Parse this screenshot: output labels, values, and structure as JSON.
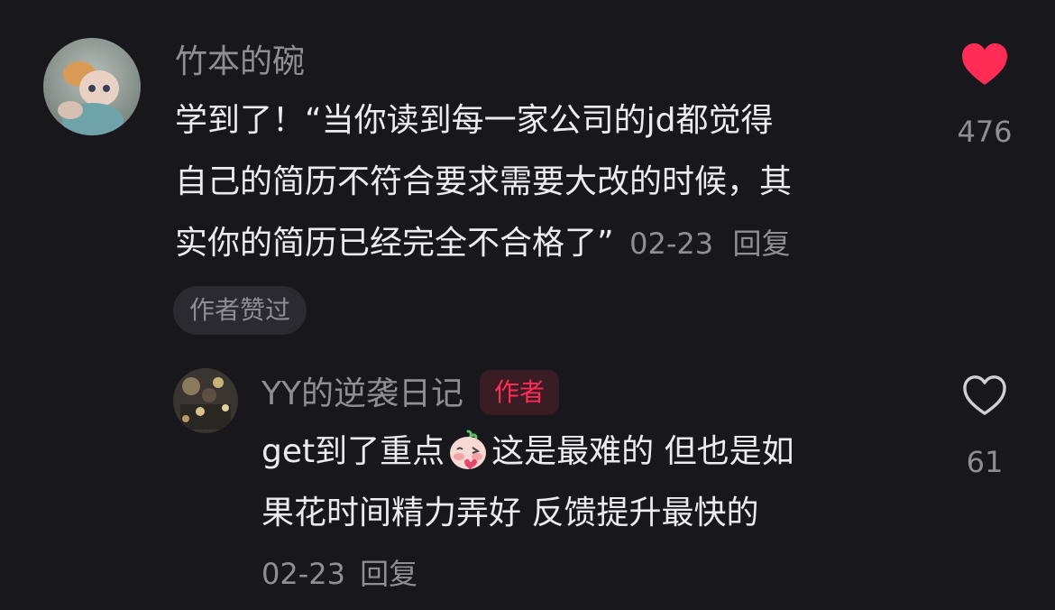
{
  "colors": {
    "background": "#18181c",
    "text_primary": "#ececf0",
    "text_secondary": "#8e8e95",
    "like_red": "#ff2c55",
    "badge_bg": "#2a2a30"
  },
  "comment": {
    "username": "竹本的碗",
    "text_lines": [
      "学到了！“当你读到每一家公司的jd都觉得",
      "自己的简历不符合要求需要大改的时候，其",
      "实你的简历已经完全不合格了”"
    ],
    "date": "02-23",
    "reply_label": "回复",
    "like_count": "476",
    "liked": true,
    "like_icon": "heart-filled-icon",
    "author_liked_label": "作者赞过"
  },
  "reply": {
    "username": "YY的逆袭日记",
    "author_badge": "作者",
    "text_line1_before_emoji": "get到了重点",
    "emoji": "blushing-face-emoji",
    "text_line1_after_emoji": "这是最难的 但也是如",
    "text_line2": "果花时间精力弄好 反馈提升最快的",
    "date": "02-23",
    "reply_label": "回复",
    "like_count": "61",
    "liked": false,
    "like_icon": "heart-outline-icon"
  }
}
